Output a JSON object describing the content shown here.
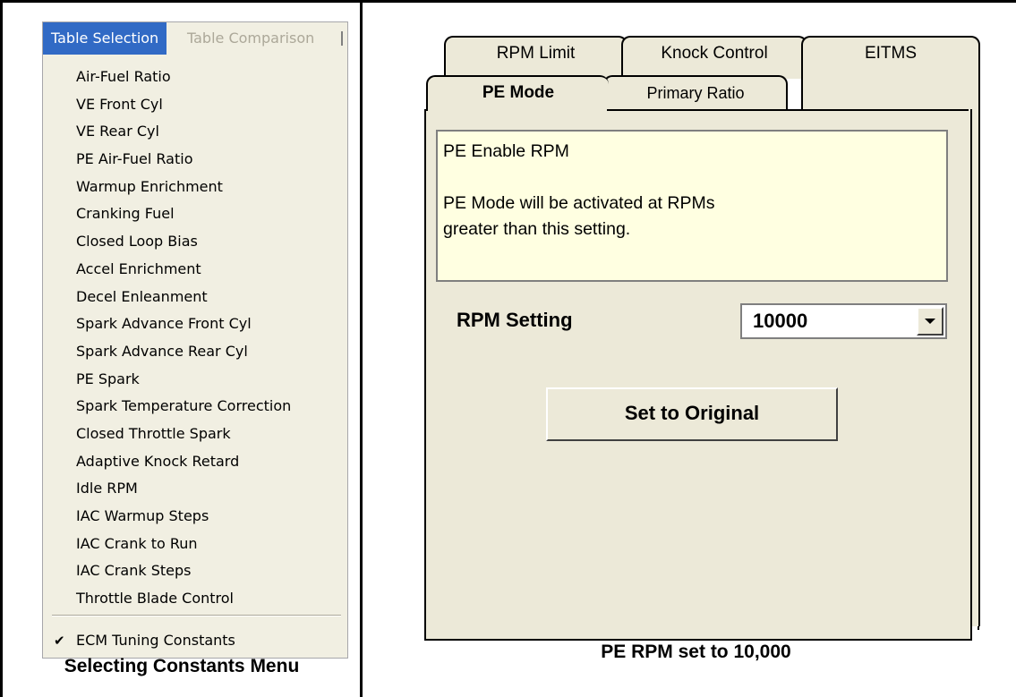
{
  "left": {
    "menubar": {
      "active_title": "Table Selection",
      "inactive_title": "Table Comparison"
    },
    "items": [
      "Air-Fuel Ratio",
      "VE Front Cyl",
      "VE Rear Cyl",
      "PE Air-Fuel Ratio",
      "Warmup Enrichment",
      "Cranking Fuel",
      "Closed Loop Bias",
      "Accel Enrichment",
      "Decel Enleanment",
      "Spark Advance Front Cyl",
      "Spark Advance Rear Cyl",
      "PE Spark",
      "Spark Temperature Correction",
      "Closed Throttle Spark",
      "Adaptive Knock Retard",
      "Idle RPM",
      "IAC Warmup Steps",
      "IAC Crank to Run",
      "IAC Crank Steps",
      "Throttle Blade Control"
    ],
    "checked_item": {
      "label": "ECM Tuning Constants",
      "icon": "check-icon"
    },
    "caption": "Selecting Constants Menu"
  },
  "right": {
    "tabs_back": [
      "RPM Limit",
      "Knock Control",
      "EITMS"
    ],
    "tabs_front": [
      "PE Mode",
      "Primary Ratio"
    ],
    "active_tab": "PE Mode",
    "info": {
      "title": "PE Enable RPM",
      "description": "PE Mode will be activated at RPMs\ngreater than this setting."
    },
    "rpm_setting": {
      "label": "RPM Setting",
      "value": "10000",
      "dropdown_icon": "chevron-down-icon"
    },
    "set_original_label": "Set to Original",
    "caption": "PE RPM set to 10,000"
  },
  "colors": {
    "menu_highlight": "#316ac5",
    "menu_bg": "#f1efe2",
    "info_bg": "#ffffe1",
    "dialog_bg": "#ece9d8"
  }
}
